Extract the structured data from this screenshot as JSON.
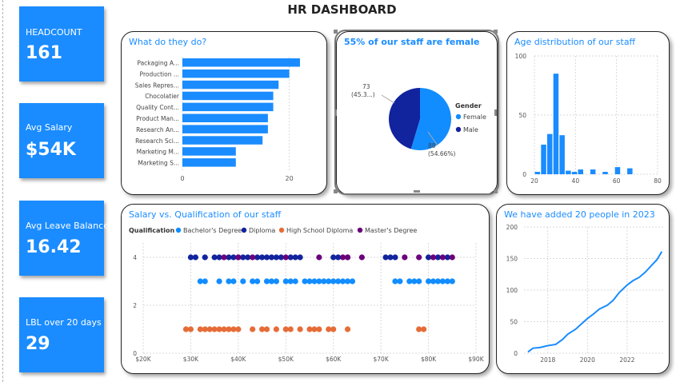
{
  "page_title": "HR DASHBOARD",
  "kpis": [
    {
      "label": "HEADCOUNT",
      "value": "161"
    },
    {
      "label": "Avg Salary",
      "value": "$54K"
    },
    {
      "label": "Avg Leave Balance",
      "value": "16.42"
    },
    {
      "label": "LBL over 20 days",
      "value": "29"
    }
  ],
  "cards": {
    "jobs": {
      "title": "What do they do?"
    },
    "gender": {
      "title": "55% of our staff are female"
    },
    "age": {
      "title": "Age distribution of our staff"
    },
    "salary": {
      "title": "Salary vs. Qualification of our staff"
    },
    "growth": {
      "title": "We have added 20 people in 2023"
    }
  },
  "colors": {
    "kpi": "#1a8cff",
    "accent": "#1a8cff",
    "female": "#118dff",
    "male": "#12239e",
    "bachelor": "#118dff",
    "diploma": "#12239e",
    "highschool": "#e66c37",
    "masters": "#6b007b"
  },
  "chart_data": [
    {
      "id": "jobs",
      "type": "bar",
      "orientation": "horizontal",
      "title": "What do they do?",
      "categories": [
        "Packaging A...",
        "Production ...",
        "Sales Repres...",
        "Chocolatier",
        "Quality Cont...",
        "Product Man...",
        "Research An...",
        "Research Sci...",
        "Marketing M...",
        "Marketing S..."
      ],
      "values": [
        22,
        20,
        18,
        17,
        17,
        16,
        16,
        15,
        10,
        10
      ],
      "xlim": [
        0,
        25
      ],
      "xticks": [
        0,
        20
      ],
      "grid": true
    },
    {
      "id": "gender",
      "type": "pie",
      "title": "55% of our staff are female",
      "legend_title": "Gender",
      "legend_position": "right",
      "slices": [
        {
          "name": "Female",
          "value": 88,
          "label": "88",
          "pct_label": "(54.66%)"
        },
        {
          "name": "Male",
          "value": 73,
          "label": "73",
          "pct_label": "(45.3...)"
        }
      ]
    },
    {
      "id": "age",
      "type": "bar",
      "title": "Age distribution of our staff",
      "bins": [
        [
          20,
          23
        ],
        [
          23,
          26
        ],
        [
          26,
          29
        ],
        [
          29,
          32
        ],
        [
          32,
          35
        ],
        [
          35,
          38
        ],
        [
          38,
          41
        ],
        [
          41,
          44
        ],
        [
          44,
          47
        ],
        [
          47,
          50
        ],
        [
          50,
          53
        ],
        [
          53,
          56
        ],
        [
          56,
          59
        ],
        [
          59,
          62
        ],
        [
          62,
          65
        ],
        [
          65,
          68
        ]
      ],
      "values": [
        2,
        25,
        34,
        85,
        33,
        3,
        2,
        4,
        0,
        4,
        0,
        2,
        0,
        6,
        0,
        5
      ],
      "xlim": [
        20,
        80
      ],
      "ylim": [
        0,
        100
      ],
      "xticks": [
        20,
        40,
        60,
        80
      ],
      "yticks": [
        0,
        50,
        100
      ],
      "grid": true
    },
    {
      "id": "salary",
      "type": "scatter",
      "title": "Salary vs. Qualification of our staff",
      "legend_title": "Qualification",
      "legend_position": "top-left",
      "xlim": [
        20000,
        90000
      ],
      "ylim": [
        0,
        4.6
      ],
      "xticks": [
        20000,
        30000,
        40000,
        50000,
        60000,
        70000,
        80000,
        90000
      ],
      "xtick_labels": [
        "$20K",
        "$30K",
        "$40K",
        "$50K",
        "$60K",
        "$70K",
        "$80K",
        "$90K"
      ],
      "yticks": [
        0,
        2,
        4
      ],
      "grid": true,
      "series": [
        {
          "name": "Bachelor's Degree",
          "y": 3,
          "x": [
            32000,
            33000,
            36000,
            38000,
            39000,
            41000,
            43000,
            44000,
            46000,
            47000,
            48000,
            50000,
            51000,
            52000,
            54000,
            55000,
            56000,
            57000,
            58000,
            59000,
            60000,
            61000,
            62000,
            63000,
            64000,
            73000,
            74000,
            76000,
            77000,
            78000,
            80000,
            81000,
            82000,
            83000,
            84000,
            85000
          ]
        },
        {
          "name": "Diploma",
          "y": 4,
          "x": [
            30000,
            31000,
            33000,
            35000,
            36000,
            38000,
            39000,
            40000,
            41000,
            42000,
            44000,
            45000,
            46000,
            47000,
            48000,
            49000,
            51000,
            52000,
            53000,
            60000,
            61000,
            63000,
            71000,
            72000,
            73000,
            80000,
            82000,
            84000
          ]
        },
        {
          "name": "High School Diploma",
          "y": 1,
          "x": [
            29000,
            30000,
            32000,
            33000,
            34000,
            35000,
            36000,
            37000,
            38000,
            39000,
            40000,
            43000,
            45000,
            46000,
            48000,
            50000,
            51000,
            53000,
            55000,
            56000,
            57000,
            59000,
            60000,
            63000,
            78000,
            79000
          ]
        },
        {
          "name": "Master's Degree",
          "y": 4,
          "x": [
            37000,
            40000,
            43000,
            50000,
            57000,
            62000,
            63000,
            66000,
            75000,
            78000,
            81000,
            83000,
            85000
          ]
        }
      ]
    },
    {
      "id": "growth",
      "type": "line",
      "title": "We have added 20 people in 2023",
      "x": [
        2017.0,
        2017.25,
        2017.6,
        2018.0,
        2018.4,
        2018.75,
        2019.0,
        2019.4,
        2019.75,
        2020.0,
        2020.3,
        2020.6,
        2021.0,
        2021.3,
        2021.6,
        2022.0,
        2022.3,
        2022.6,
        2022.9,
        2023.2,
        2023.5,
        2023.75
      ],
      "y": [
        2,
        8,
        9,
        12,
        14,
        22,
        30,
        38,
        48,
        55,
        62,
        70,
        76,
        84,
        96,
        108,
        115,
        120,
        128,
        138,
        148,
        161
      ],
      "xlim": [
        2016.8,
        2023.9
      ],
      "ylim": [
        0,
        200
      ],
      "xticks": [
        2018,
        2020,
        2022
      ],
      "yticks": [
        0,
        50,
        100,
        150,
        200
      ],
      "grid": true
    }
  ]
}
